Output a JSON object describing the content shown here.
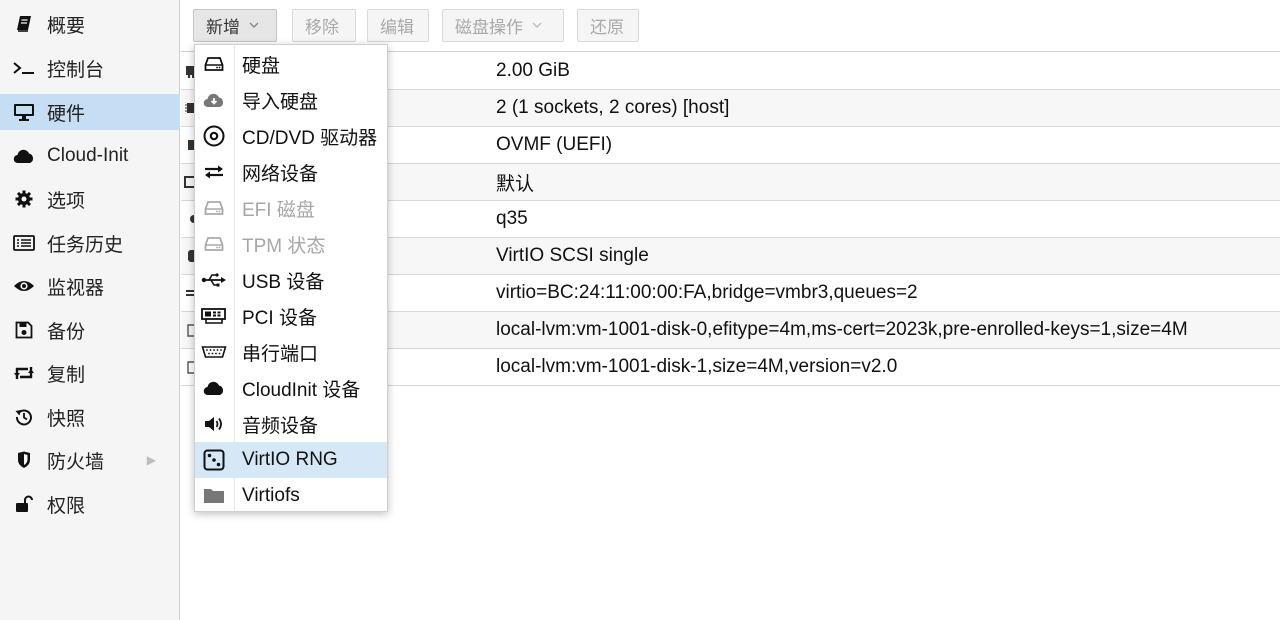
{
  "sidebar": {
    "items": [
      {
        "label": "概要",
        "icon": "book-icon"
      },
      {
        "label": "控制台",
        "icon": "terminal-icon"
      },
      {
        "label": "硬件",
        "icon": "monitor-icon",
        "active": true
      },
      {
        "label": "Cloud-Init",
        "icon": "cloud-icon"
      },
      {
        "label": "选项",
        "icon": "gear-icon"
      },
      {
        "label": "任务历史",
        "icon": "list-icon"
      },
      {
        "label": "监视器",
        "icon": "eye-icon"
      },
      {
        "label": "备份",
        "icon": "save-icon"
      },
      {
        "label": "复制",
        "icon": "retweet-icon"
      },
      {
        "label": "快照",
        "icon": "history-icon"
      },
      {
        "label": "防火墙",
        "icon": "shield-icon"
      },
      {
        "label": "权限",
        "icon": "unlock-icon"
      }
    ]
  },
  "toolbar": {
    "add_label": "新增",
    "remove_label": "移除",
    "edit_label": "编辑",
    "disk_action_label": "磁盘操作",
    "revert_label": "还原"
  },
  "hardware": {
    "rows": [
      {
        "value": "2.00 GiB"
      },
      {
        "value": "2 (1 sockets, 2 cores) [host]"
      },
      {
        "value": "OVMF (UEFI)"
      },
      {
        "value": "默认"
      },
      {
        "value": "q35"
      },
      {
        "value": "VirtIO SCSI single"
      },
      {
        "value": "virtio=BC:24:11:00:00:FA,bridge=vmbr3,queues=2"
      },
      {
        "value": "local-lvm:vm-1001-disk-0,efitype=4m,ms-cert=2023k,pre-enrolled-keys=1,size=4M"
      },
      {
        "value": "local-lvm:vm-1001-disk-1,size=4M,version=v2.0"
      }
    ]
  },
  "add_menu": {
    "items": [
      {
        "label": "硬盘",
        "icon": "hdd-icon"
      },
      {
        "label": "导入硬盘",
        "icon": "cloud-download-icon"
      },
      {
        "label": "CD/DVD 驱动器",
        "icon": "disc-icon"
      },
      {
        "label": "网络设备",
        "icon": "exchange-icon"
      },
      {
        "label": "EFI 磁盘",
        "icon": "hdd-icon",
        "disabled": true
      },
      {
        "label": "TPM 状态",
        "icon": "hdd-icon",
        "disabled": true
      },
      {
        "label": "USB 设备",
        "icon": "usb-icon"
      },
      {
        "label": "PCI 设备",
        "icon": "pci-card-icon"
      },
      {
        "label": "串行端口",
        "icon": "serial-port-icon"
      },
      {
        "label": "CloudInit 设备",
        "icon": "cloud-icon"
      },
      {
        "label": "音频设备",
        "icon": "volume-icon"
      },
      {
        "label": "VirtIO RNG",
        "icon": "dice-icon",
        "highlighted": true
      },
      {
        "label": "Virtiofs",
        "icon": "folder-icon"
      }
    ]
  }
}
